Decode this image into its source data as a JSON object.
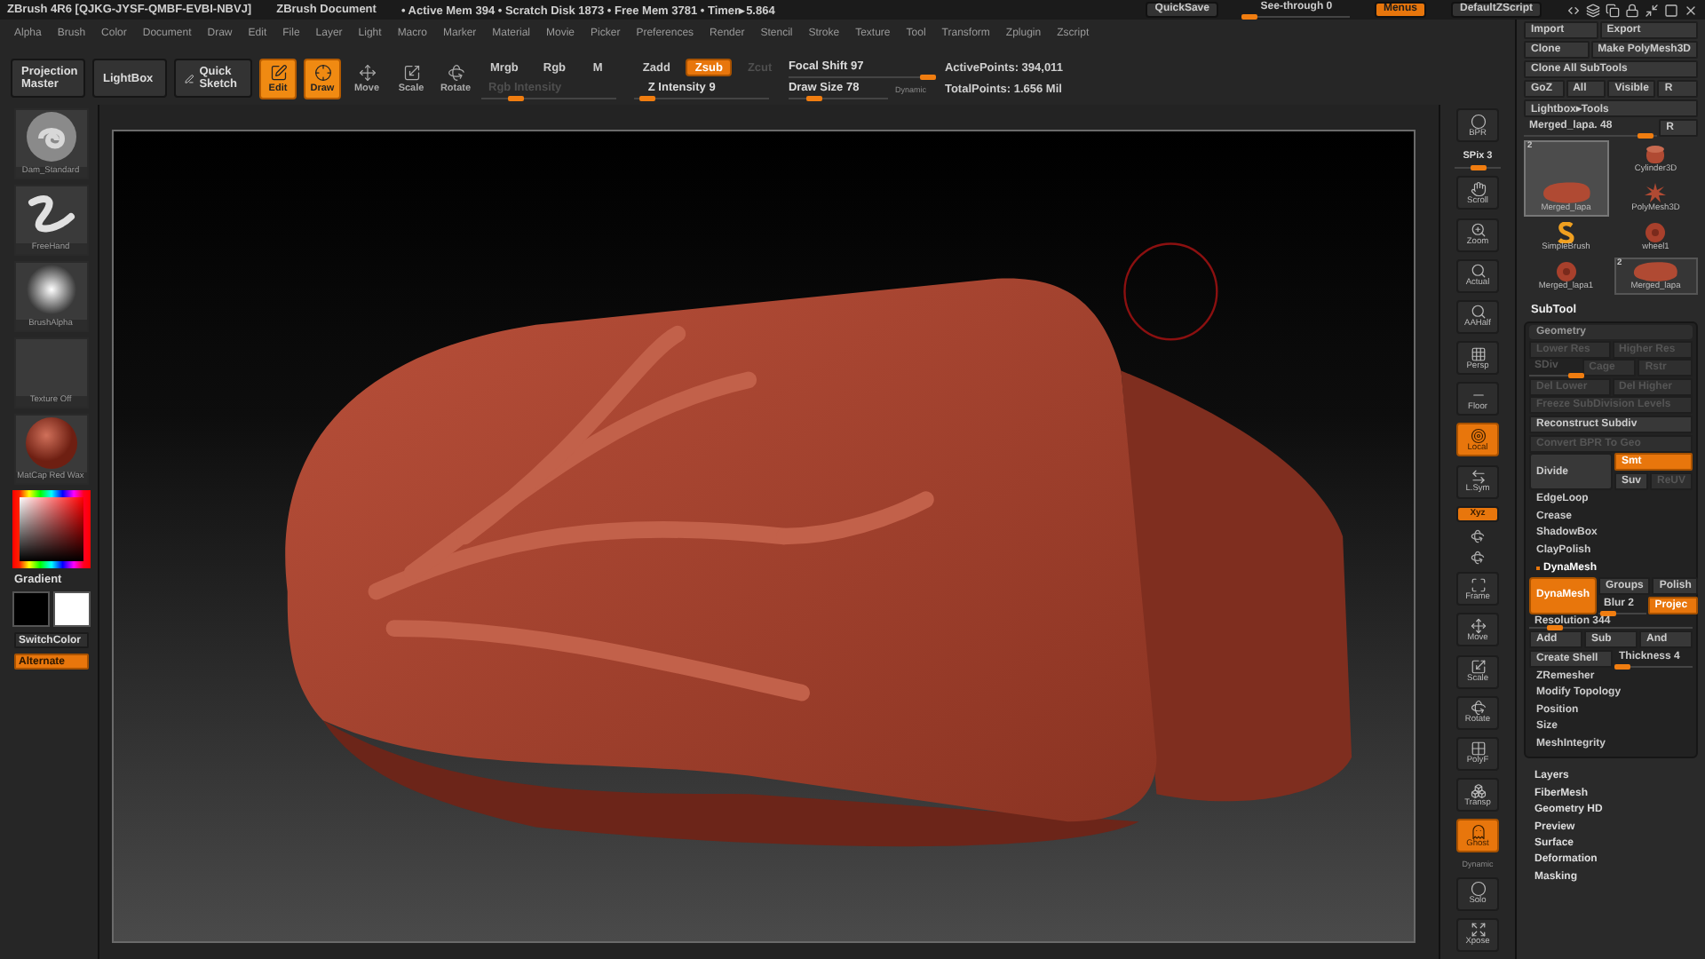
{
  "title_bar": {
    "app": "ZBrush 4R6 [QJKG-JYSF-QMBF-EVBI-NBVJ]",
    "document": "ZBrush Document",
    "stats": "• Active Mem 394 • Scratch Disk 1873 • Free Mem 3781 • Timer▸5.864",
    "quicksave": "QuickSave",
    "see_through": {
      "label": "See-through  0",
      "level": 0.05
    },
    "menus": {
      "label": "Menus",
      "selected": true
    },
    "script": "DefaultZScript"
  },
  "menu_bar": [
    "Alpha",
    "Brush",
    "Color",
    "Document",
    "Draw",
    "Edit",
    "File",
    "Layer",
    "Light",
    "Macro",
    "Marker",
    "Material",
    "Movie",
    "Picker",
    "Preferences",
    "Render",
    "Stencil",
    "Stroke",
    "Texture",
    "Tool",
    "Transform",
    "Zplugin",
    "Zscript"
  ],
  "toolbar": {
    "buttons": [
      {
        "label": "Projection Master",
        "kind": "text"
      },
      {
        "label": "LightBox",
        "kind": "text"
      },
      {
        "label": "Quick Sketch",
        "kind": "sketch"
      }
    ],
    "modes": [
      {
        "label": "Edit",
        "selected": true
      },
      {
        "label": "Draw",
        "selected": true
      },
      {
        "label": "Move",
        "selected": false
      },
      {
        "label": "Scale",
        "selected": false
      },
      {
        "label": "Rotate",
        "selected": false
      }
    ],
    "color_modes": [
      {
        "label": "Mrgb",
        "selected": false
      },
      {
        "label": "Rgb",
        "selected": false
      },
      {
        "label": "M",
        "selected": false
      }
    ],
    "rgb_intensity": {
      "label": "Rgb Intensity",
      "disabled": true,
      "level": 0.25
    },
    "z_modes": [
      {
        "label": "Zadd",
        "selected": false,
        "disabled": false
      },
      {
        "label": "Zsub",
        "selected": true,
        "disabled": false
      },
      {
        "label": "Zcut",
        "selected": false,
        "disabled": true
      }
    ],
    "z_intensity": {
      "label": "Z Intensity 9",
      "level": 0.09
    },
    "focal_shift": {
      "label": "Focal Shift 97",
      "level": 0.97
    },
    "draw_size": {
      "label": "Draw Size 78",
      "level": 0.25
    },
    "dynamic": "Dynamic",
    "active_points": "ActivePoints: 394,011",
    "total_points": "TotalPoints: 1.656 Mil"
  },
  "shelf": {
    "thumbs": [
      {
        "label": "Dam_Standard",
        "kind": "brush"
      },
      {
        "label": "FreeHand",
        "kind": "stroke"
      },
      {
        "label": "BrushAlpha",
        "kind": "alpha"
      },
      {
        "label": "Texture Off",
        "kind": "texture"
      },
      {
        "label": "MatCap Red Wax",
        "kind": "material"
      }
    ],
    "gradient": "Gradient",
    "swatches": [
      {
        "color": "#000000"
      },
      {
        "color": "#ffffff"
      }
    ],
    "switch_color": "SwitchColor",
    "alternate": {
      "label": "Alternate",
      "selected": true
    }
  },
  "view_tools": [
    {
      "kind": "button",
      "label": "BPR",
      "on": false
    },
    {
      "kind": "slider",
      "label": "SPix 3",
      "level": 0.5
    },
    {
      "kind": "button",
      "label": "Scroll",
      "on": false
    },
    {
      "kind": "button",
      "label": "Zoom",
      "on": false
    },
    {
      "kind": "button",
      "label": "Actual",
      "on": false
    },
    {
      "kind": "button",
      "label": "AAHalf",
      "on": false
    },
    {
      "kind": "button",
      "label": "Persp",
      "on": false
    },
    {
      "kind": "button",
      "label": "Floor",
      "on": false
    },
    {
      "kind": "button",
      "label": "Local",
      "on": true
    },
    {
      "kind": "button",
      "label": "L.Sym",
      "on": false
    },
    {
      "kind": "toggle",
      "label": "Xyz",
      "on": true
    },
    {
      "kind": "glyph"
    },
    {
      "kind": "glyph"
    },
    {
      "kind": "button",
      "label": "Frame",
      "on": false
    },
    {
      "kind": "button",
      "label": "Move",
      "on": false
    },
    {
      "kind": "button",
      "label": "Scale",
      "on": false
    },
    {
      "kind": "button",
      "label": "Rotate",
      "on": false
    },
    {
      "kind": "button",
      "label": "PolyF",
      "on": false
    },
    {
      "kind": "button",
      "label": "Transp",
      "on": false
    },
    {
      "kind": "button",
      "label": "Ghost",
      "on": true
    },
    {
      "kind": "caption",
      "label": "Dynamic"
    },
    {
      "kind": "button",
      "label": "Solo",
      "on": false
    },
    {
      "kind": "button",
      "label": "Xpose",
      "on": false
    }
  ],
  "tool_panel": {
    "rows": [
      [
        {
          "label": "Import"
        },
        {
          "label": "Export"
        }
      ],
      [
        {
          "label": "Clone"
        },
        {
          "label": "Make PolyMesh3D"
        }
      ],
      [
        {
          "label": "Clone All SubTools"
        }
      ],
      [
        {
          "label": "GoZ"
        },
        {
          "label": "All"
        },
        {
          "label": "Visible"
        },
        {
          "label": "R"
        }
      ],
      [
        {
          "label": "Lightbox▸Tools"
        }
      ]
    ],
    "current": {
      "label": "Merged_lapa. 48",
      "level": 0.9,
      "reset": "R"
    },
    "tools": [
      {
        "label": "Merged_lapa",
        "kind": "model",
        "selected": true,
        "count": "2"
      },
      {
        "label": "Cylinder3D",
        "kind": "cylinder",
        "selected": false
      },
      {
        "label": "PolyMesh3D",
        "kind": "star",
        "selected": false
      },
      {
        "label": "SimpleBrush",
        "kind": "brush",
        "selected": false
      },
      {
        "label": "wheel1",
        "kind": "wheel",
        "selected": false
      },
      {
        "label": "Merged_lapa1",
        "kind": "wheel",
        "selected": false
      },
      {
        "label": "Merged_lapa",
        "kind": "model",
        "selected": false,
        "count": "2"
      }
    ]
  },
  "subtool": "SubTool",
  "geometry": {
    "title": "Geometry",
    "rows": [
      {
        "kind": "buttons",
        "items": [
          {
            "kind": "button",
            "label": "Lower Res",
            "on": false,
            "disabled": true
          },
          {
            "kind": "button",
            "label": "Higher Res",
            "on": false,
            "disabled": true
          }
        ]
      },
      {
        "kind": "buttons",
        "items": [
          {
            "kind": "slider",
            "label": "SDiv",
            "level": 0.9,
            "disabled": true
          },
          {
            "kind": "button",
            "label": "Cage",
            "on": false,
            "disabled": true
          },
          {
            "kind": "button",
            "label": "Rstr",
            "on": false,
            "disabled": true
          }
        ]
      },
      {
        "kind": "buttons",
        "items": [
          {
            "kind": "button",
            "label": "Del Lower",
            "on": false,
            "disabled": true
          },
          {
            "kind": "button",
            "label": "Del Higher",
            "on": false,
            "disabled": true
          }
        ]
      },
      {
        "kind": "buttons",
        "items": [
          {
            "kind": "button",
            "label": "Freeze SubDivision Levels",
            "on": false,
            "disabled": true
          }
        ]
      },
      {
        "kind": "buttons",
        "items": [
          {
            "kind": "button",
            "label": "Reconstruct Subdiv",
            "on": false,
            "disabled": false
          }
        ]
      },
      {
        "kind": "buttons",
        "items": [
          {
            "kind": "button",
            "label": "Convert BPR To Geo",
            "on": false,
            "disabled": true
          }
        ]
      },
      {
        "kind": "split",
        "main": {
          "label": "Divide",
          "on": false
        },
        "side": [
          [
            {
              "kind": "button",
              "label": "Smt",
              "on": true,
              "disabled": false
            }
          ],
          [
            {
              "kind": "button",
              "label": "Suv",
              "on": false,
              "disabled": false
            },
            {
              "kind": "button",
              "label": "ReUV",
              "on": false,
              "disabled": true
            }
          ]
        ]
      },
      {
        "kind": "section",
        "label": "EdgeLoop",
        "expanded": false
      },
      {
        "kind": "section",
        "label": "Crease",
        "expanded": false
      },
      {
        "kind": "section",
        "label": "ShadowBox",
        "expanded": false
      },
      {
        "kind": "section",
        "label": "ClayPolish",
        "expanded": false
      },
      {
        "kind": "section",
        "label": "DynaMesh",
        "expanded": true
      },
      {
        "kind": "split",
        "main": {
          "label": "DynaMesh",
          "on": true
        },
        "side": [
          [
            {
              "kind": "button",
              "label": "Groups",
              "on": false,
              "disabled": false
            },
            {
              "kind": "button",
              "label": "Polish",
              "on": false,
              "disabled": false
            }
          ],
          [
            {
              "kind": "slider",
              "label": "Blur 2",
              "level": 0.2,
              "disabled": false
            },
            {
              "kind": "button",
              "label": "Projec",
              "on": true,
              "disabled": false
            }
          ]
        ]
      },
      {
        "kind": "slider",
        "label": "Resolution 344",
        "level": 0.15
      },
      {
        "kind": "buttons",
        "items": [
          {
            "kind": "button",
            "label": "Add",
            "on": false,
            "disabled": false
          },
          {
            "kind": "button",
            "label": "Sub",
            "on": false,
            "disabled": false
          },
          {
            "kind": "button",
            "label": "And",
            "on": false,
            "disabled": false
          }
        ]
      },
      {
        "kind": "buttons",
        "items": [
          {
            "kind": "button",
            "label": "Create Shell",
            "on": false,
            "disabled": false
          },
          {
            "kind": "slider",
            "label": "Thickness 4",
            "level": 0.1,
            "disabled": false
          }
        ]
      },
      {
        "kind": "section",
        "label": "ZRemesher",
        "expanded": false
      },
      {
        "kind": "section",
        "label": "Modify Topology",
        "expanded": false
      },
      {
        "kind": "section",
        "label": "Position",
        "expanded": false
      },
      {
        "kind": "section",
        "label": "Size",
        "expanded": false
      },
      {
        "kind": "section",
        "label": "MeshIntegrity",
        "expanded": false
      }
    ]
  },
  "palettes": [
    "Layers",
    "FiberMesh",
    "Geometry HD",
    "Preview",
    "Surface",
    "Deformation",
    "Masking"
  ]
}
